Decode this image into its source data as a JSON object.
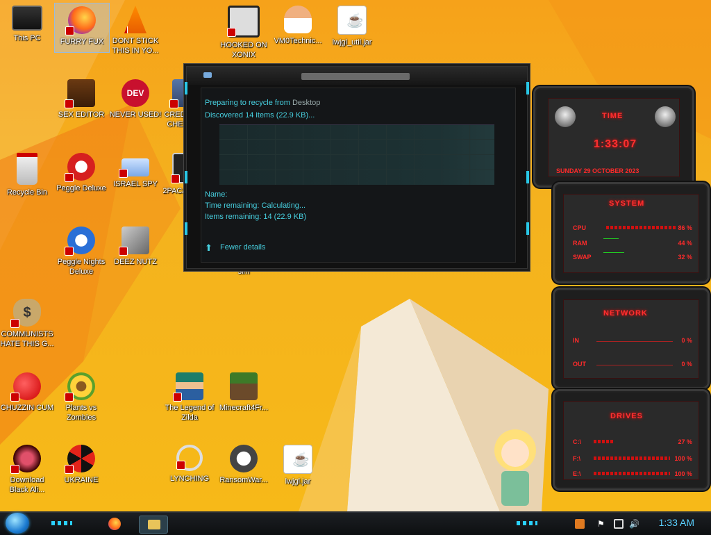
{
  "desktop": {
    "icons": [
      {
        "label": "This PC"
      },
      {
        "label": "FURRY FUX"
      },
      {
        "label": "DONT STICK THIS IN YO..."
      },
      {
        "label": "HOOKED ON XONIX"
      },
      {
        "label": "VM0Technic..."
      },
      {
        "label": "lwjgl_util.jar"
      },
      {
        "label": "SEX EDITOR"
      },
      {
        "label": "NEVER USED!"
      },
      {
        "label": "CRED CHE"
      },
      {
        "label": "Recycle Bin"
      },
      {
        "label": "Peggle Deluxe"
      },
      {
        "label": "ISRAEL SPY"
      },
      {
        "label": "2PACA"
      },
      {
        "label": "Peggle Nights Deluxe"
      },
      {
        "label": "DEEZ NUTZ"
      },
      {
        "label": "sim"
      },
      {
        "label": "COMMUNISTS HATE THIS G..."
      },
      {
        "label": "CHUZZIN CUM"
      },
      {
        "label": "Plants vs Zombies"
      },
      {
        "label": "The Legend of Zilda"
      },
      {
        "label": "Minecraft4Fr..."
      },
      {
        "label": "Download Black Ali..."
      },
      {
        "label": "UKRAINE"
      },
      {
        "label": "LYNCHING"
      },
      {
        "label": "RansomWar..."
      },
      {
        "label": "lwjgl.jar"
      }
    ]
  },
  "dialog": {
    "preparing": "Preparing to recycle from",
    "source": "Desktop",
    "discovered": "Discovered 14 items (22.9 KB)...",
    "name_label": "Name:",
    "time_remaining": "Time remaining:  Calculating...",
    "items_remaining": "Items remaining:  14 (22.9 KB)",
    "fewer_details": "Fewer details"
  },
  "gadgets": {
    "time": {
      "title": "TIME",
      "clock": "1:33:07",
      "date": "SUNDAY 29 OCTOBER 2023"
    },
    "system": {
      "title": "SYSTEM",
      "rows": [
        {
          "label": "CPU",
          "value": "86 %",
          "level": 0.86
        },
        {
          "label": "RAM",
          "value": "44 %",
          "level": 0.44
        },
        {
          "label": "SWAP",
          "value": "32 %",
          "level": 0.32
        }
      ]
    },
    "network": {
      "title": "NETWORK",
      "rows": [
        {
          "label": "IN",
          "value": "0 %"
        },
        {
          "label": "OUT",
          "value": "0 %"
        }
      ]
    },
    "drives": {
      "title": "DRIVES",
      "rows": [
        {
          "label": "C:\\",
          "value": "27 %",
          "level": 0.27
        },
        {
          "label": "F:\\",
          "value": "100 %",
          "level": 1.0
        },
        {
          "label": "E:\\",
          "value": "100 %",
          "level": 1.0
        }
      ]
    }
  },
  "taskbar": {
    "clock": "1:33 AM"
  },
  "colors": {
    "accent_cyan": "#29c7e6",
    "gadget_red": "#ff2a2a",
    "wallpaper": "#f4b21e"
  }
}
